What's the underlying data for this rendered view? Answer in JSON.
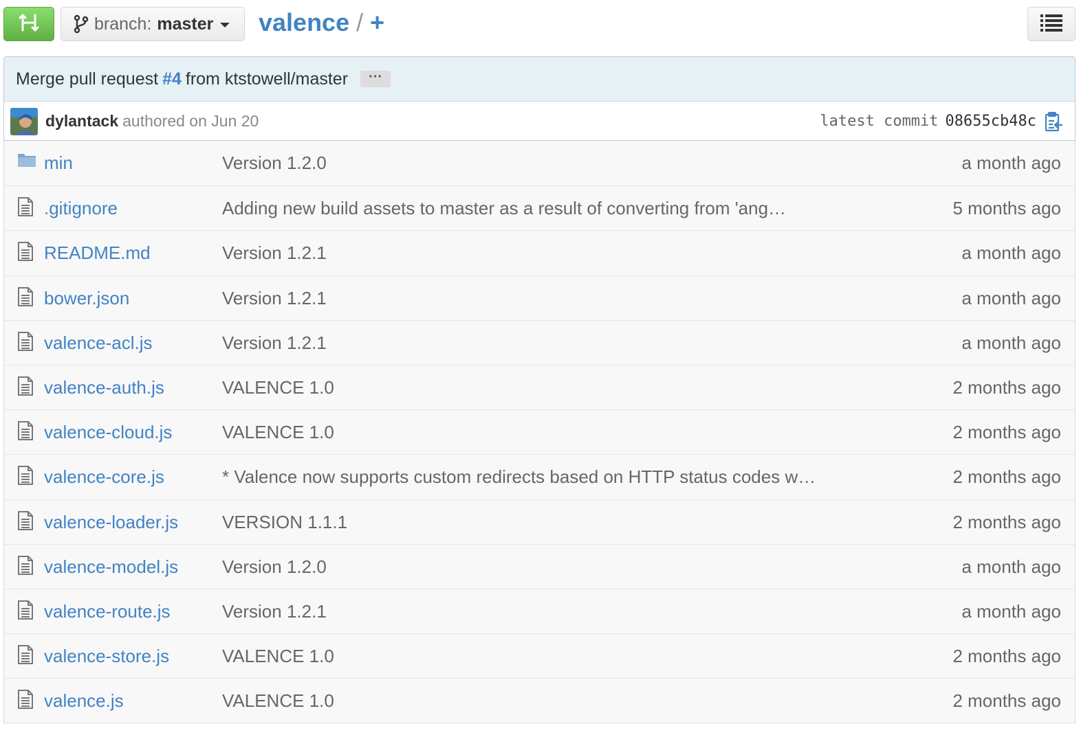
{
  "toolbar": {
    "branch_label": "branch:",
    "branch_value": "master",
    "repo_name": "valence",
    "separator": "/",
    "plus": "+"
  },
  "commit": {
    "message_prefix": "Merge pull request",
    "pr_number": "#4",
    "message_suffix": "from ktstowell/master",
    "more": "···",
    "author": "dylantack",
    "authored": "authored on Jun 20",
    "latest_label": "latest commit",
    "sha": "08655cb48c"
  },
  "files": [
    {
      "name": "min",
      "type": "folder",
      "message": "Version 1.2.0",
      "age": "a month ago"
    },
    {
      "name": ".gitignore",
      "type": "file",
      "message": "Adding new build assets to master as a result of converting from 'ang…",
      "age": "5 months ago"
    },
    {
      "name": "README.md",
      "type": "file",
      "message": "Version 1.2.1",
      "age": "a month ago"
    },
    {
      "name": "bower.json",
      "type": "file",
      "message": "Version 1.2.1",
      "age": "a month ago"
    },
    {
      "name": "valence-acl.js",
      "type": "file",
      "message": "Version 1.2.1",
      "age": "a month ago"
    },
    {
      "name": "valence-auth.js",
      "type": "file",
      "message": "VALENCE 1.0",
      "age": "2 months ago"
    },
    {
      "name": "valence-cloud.js",
      "type": "file",
      "message": "VALENCE 1.0",
      "age": "2 months ago"
    },
    {
      "name": "valence-core.js",
      "type": "file",
      "message": "* Valence now supports custom redirects based on HTTP status codes w…",
      "age": "2 months ago"
    },
    {
      "name": "valence-loader.js",
      "type": "file",
      "message": "VERSION 1.1.1",
      "age": "2 months ago"
    },
    {
      "name": "valence-model.js",
      "type": "file",
      "message": "Version 1.2.0",
      "age": "a month ago"
    },
    {
      "name": "valence-route.js",
      "type": "file",
      "message": "Version 1.2.1",
      "age": "a month ago"
    },
    {
      "name": "valence-store.js",
      "type": "file",
      "message": "VALENCE 1.0",
      "age": "2 months ago"
    },
    {
      "name": "valence.js",
      "type": "file",
      "message": "VALENCE 1.0",
      "age": "2 months ago"
    }
  ],
  "colors": {
    "link": "#4183c4",
    "compare_green": "#60b044",
    "commit_bg": "#e6f1f6",
    "row_bg": "#f8f8f8"
  }
}
